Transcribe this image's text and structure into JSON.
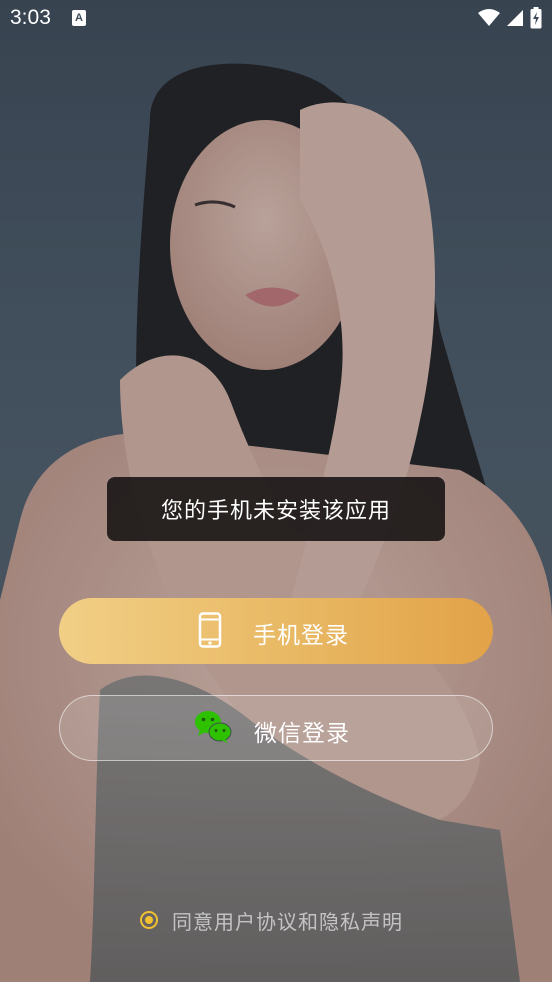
{
  "status_bar": {
    "time": "3:03",
    "notification_icon": "a-letter-icon",
    "right_icons": [
      "wifi-icon",
      "cell-signal-icon",
      "battery-charging-icon"
    ]
  },
  "toast": {
    "message": "您的手机未安装该应用"
  },
  "login": {
    "phone_label": "手机登录",
    "phone_icon": "phone-icon",
    "wechat_label": "微信登录",
    "wechat_icon": "wechat-icon"
  },
  "agreement": {
    "text": "同意用户协议和隐私声明",
    "checked": true
  },
  "colors": {
    "phone_button_start": "#f1cf86",
    "phone_button_end": "#e2a248",
    "wechat_green": "#2dc100",
    "radio_accent": "#f2c030"
  }
}
